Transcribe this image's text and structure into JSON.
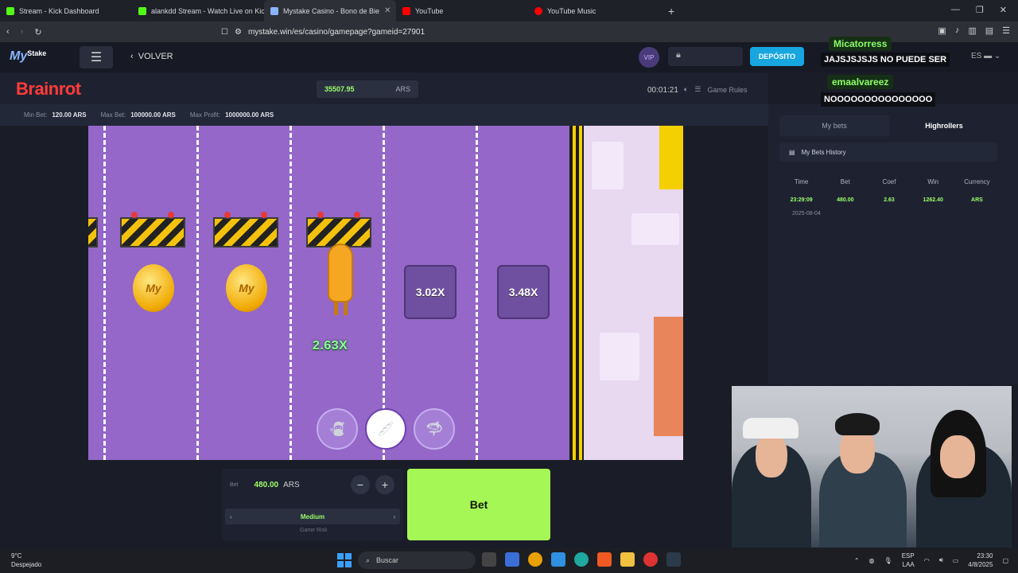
{
  "browser": {
    "tabs": [
      {
        "label": "Stream - Kick Dashboard",
        "color": "#53fc18"
      },
      {
        "label": "alankdd Stream - Watch Live on Kick",
        "color": "#53fc18"
      },
      {
        "label": "Mystake Casino - Bono de Bie",
        "color": "#8ab4ff"
      },
      {
        "label": "YouTube",
        "color": "#ff0000"
      },
      {
        "label": "YouTube Music",
        "color": "#ff0000"
      }
    ],
    "new_tab": "+",
    "url": "mystake.win/es/casino/gamepage?gameid=27901"
  },
  "site": {
    "logo": "My",
    "logo_sub": "Stake",
    "back_label": "VOLVER",
    "vip_label": "VIP",
    "deposit_label": "DEPÓSITO",
    "language": "ES"
  },
  "game": {
    "title": "Brainrot",
    "balance": "35507.95",
    "balance_currency": "ARS",
    "timer": "00:01:21",
    "rules_label": "Game Rules",
    "limits": {
      "min_bet_label": "Min Bet:",
      "min_bet": "120.00 ARS",
      "max_bet_label": "Max Bet:",
      "max_bet": "100000.00 ARS",
      "max_profit_label": "Max Profit:",
      "max_profit": "1000000.00 ARS"
    },
    "multipliers": [
      "3.02X",
      "3.48X"
    ],
    "current_multiplier": "2.63X",
    "coin_label": "My"
  },
  "controls": {
    "bet_label": "Bet",
    "bet_amount": "480.00",
    "bet_currency": "ARS",
    "minus": "−",
    "plus": "+",
    "risk_value": "Medium",
    "risk_label": "Game Risk",
    "bet_button": "Bet"
  },
  "panel": {
    "tab_my_bets": "My bets",
    "tab_highrollers": "Highrollers",
    "history_title": "My Bets History",
    "headers": [
      "Time",
      "Bet",
      "Coef",
      "Win",
      "Currency"
    ],
    "rows": [
      {
        "time": "23:29:09",
        "bet": "480.00",
        "coef": "2.63",
        "win": "1262.40",
        "currency": "ARS"
      }
    ],
    "date": "2025-08-04"
  },
  "chat": [
    {
      "name": "Micatorress",
      "message": "JAJSJSJSJS NO PUEDE SER"
    },
    {
      "name": "emaalvareez",
      "message": "NOOOOOOOOOOOOOOO"
    }
  ],
  "taskbar": {
    "temp": "9°C",
    "weather": "Despejado",
    "search_label": "Buscar",
    "lang_top": "ESP",
    "lang_bottom": "LAA",
    "time": "23:30",
    "date": "4/8/2025"
  }
}
